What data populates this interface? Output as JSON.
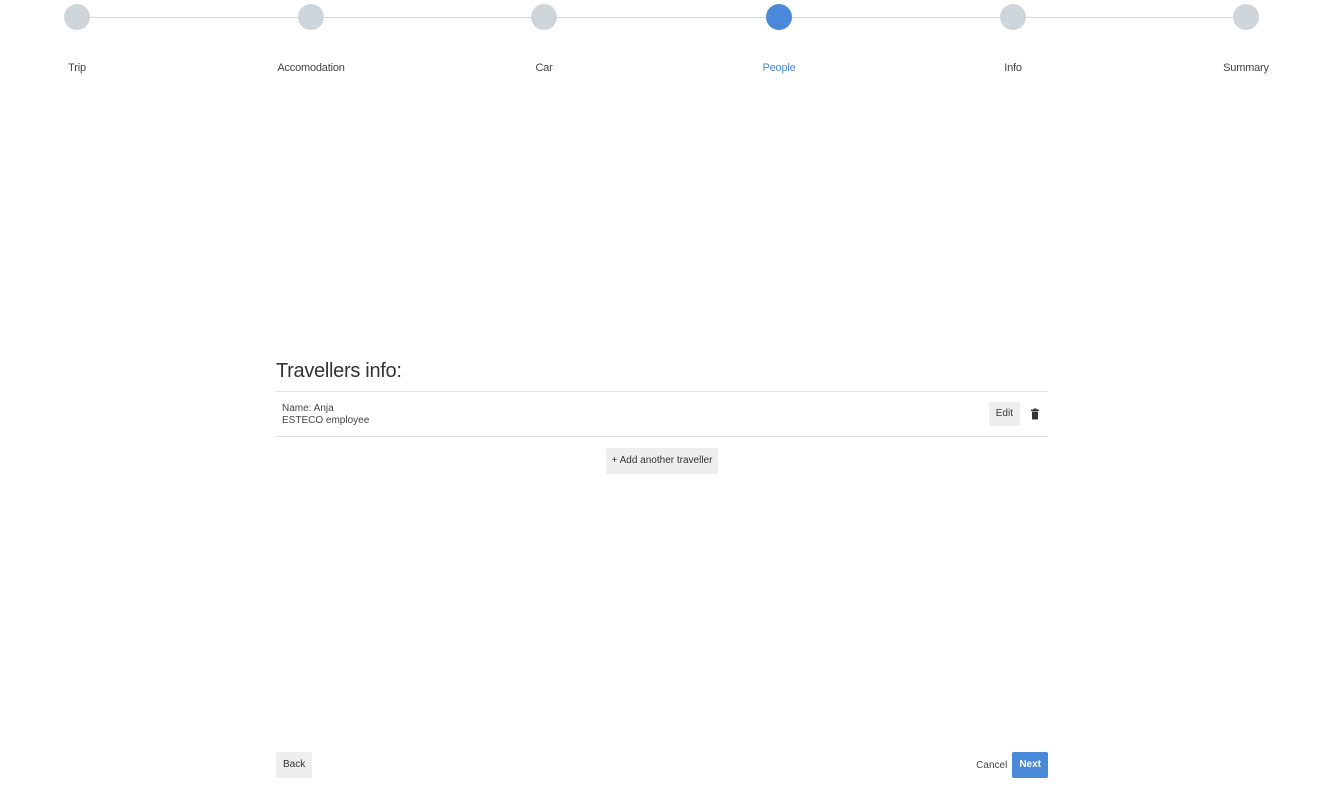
{
  "stepper": {
    "active_index": 3,
    "active_color": "#4a88d8",
    "inactive_color": "#cfd6db",
    "steps": [
      {
        "label": "Trip"
      },
      {
        "label": "Accomodation"
      },
      {
        "label": "Car"
      },
      {
        "label": "People"
      },
      {
        "label": "Info"
      },
      {
        "label": "Summary"
      }
    ]
  },
  "travellers": {
    "title": "Travellers info:",
    "list": [
      {
        "name_line": "Name: Anja",
        "detail_line": "ESTECO employee",
        "edit_label": "Edit",
        "delete_icon": "trash-icon"
      }
    ],
    "add_label": "+ Add another traveller"
  },
  "footer": {
    "back_label": "Back",
    "cancel_label": "Cancel",
    "next_label": "Next"
  }
}
